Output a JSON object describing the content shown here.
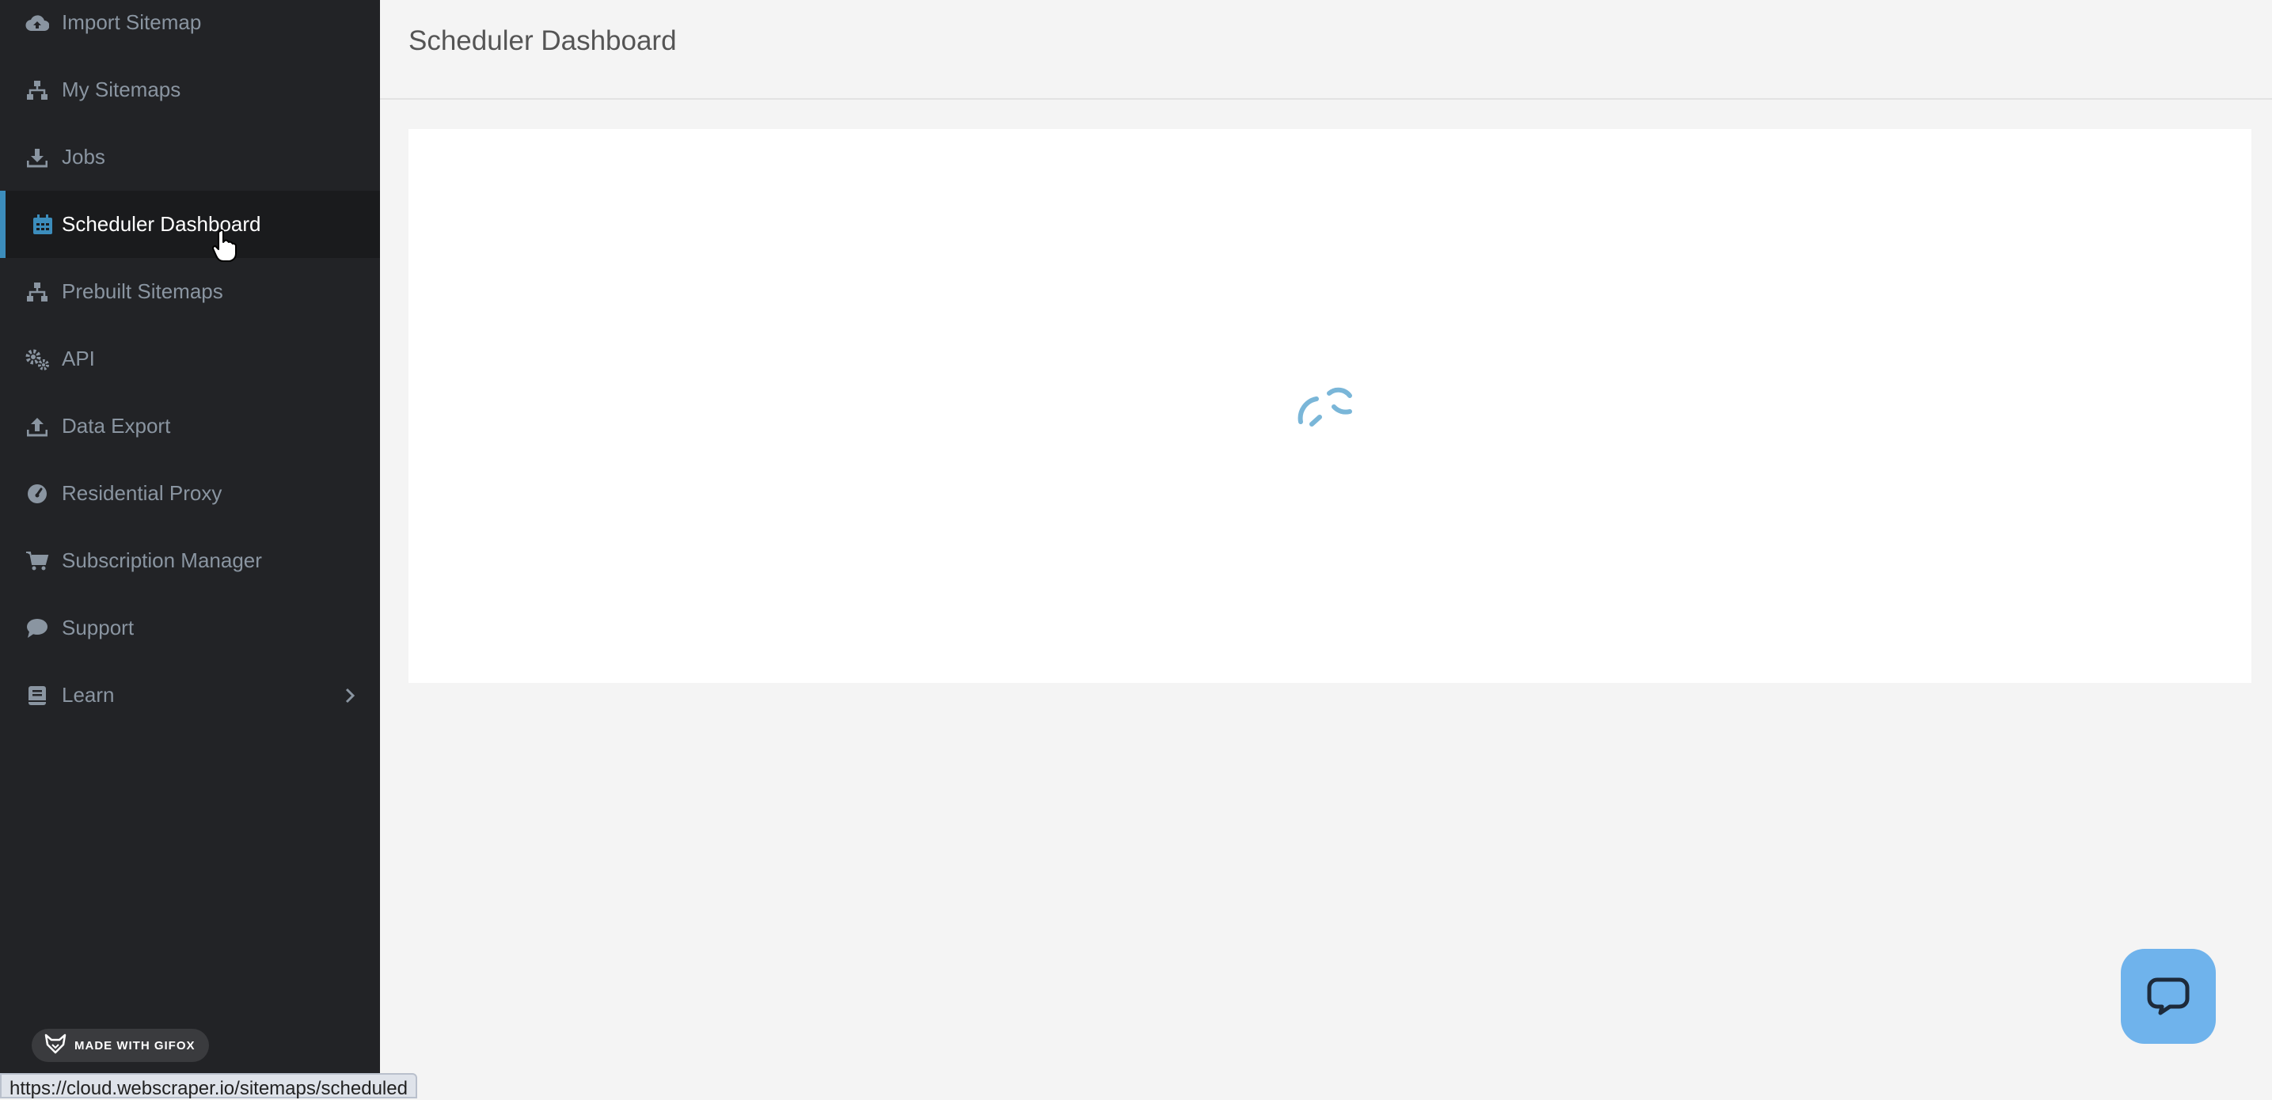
{
  "sidebar": {
    "items": [
      {
        "label": "Import Sitemap",
        "icon": "cloud-upload-icon",
        "active": false
      },
      {
        "label": "My Sitemaps",
        "icon": "sitemap-icon",
        "active": false
      },
      {
        "label": "Jobs",
        "icon": "download-icon",
        "active": false
      },
      {
        "label": "Scheduler Dashboard",
        "icon": "calendar-icon",
        "active": true
      },
      {
        "label": "Prebuilt Sitemaps",
        "icon": "sitemap-icon",
        "active": false
      },
      {
        "label": "API",
        "icon": "gears-icon",
        "active": false
      },
      {
        "label": "Data Export",
        "icon": "upload-icon",
        "active": false
      },
      {
        "label": "Residential Proxy",
        "icon": "gauge-icon",
        "active": false
      },
      {
        "label": "Subscription Manager",
        "icon": "cart-icon",
        "active": false
      },
      {
        "label": "Support",
        "icon": "comment-icon",
        "active": false
      },
      {
        "label": "Learn",
        "icon": "book-icon",
        "active": false
      }
    ]
  },
  "header": {
    "title": "Scheduler Dashboard"
  },
  "badge": {
    "label": "MADE WITH GIFOX"
  },
  "status_bar": {
    "url": "https://cloud.webscraper.io/sitemaps/scheduled"
  },
  "colors": {
    "sidebar_bg": "#222326",
    "accent": "#3c8dbc",
    "spinner": "#7ab6d8",
    "chat_button": "#6fb3ec"
  }
}
